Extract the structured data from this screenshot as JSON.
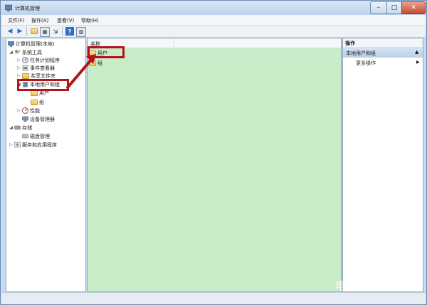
{
  "window": {
    "title": "计算机管理"
  },
  "menubar": {
    "items": [
      "文件(F)",
      "操作(A)",
      "查看(V)",
      "帮助(H)"
    ]
  },
  "tree": {
    "root": "计算机管理(本地)",
    "system_tools": "系统工具",
    "task_scheduler": "任务计划程序",
    "event_viewer": "事件查看器",
    "shared_folders": "共享文件夹",
    "local_users_groups": "本地用户和组",
    "users": "用户",
    "groups": "组",
    "performance": "性能",
    "device_manager": "设备管理器",
    "storage": "存储",
    "disk_management": "磁盘管理",
    "services_apps": "服务和应用程序"
  },
  "list": {
    "column_name": "名称",
    "rows": [
      "用户",
      "组"
    ]
  },
  "actions": {
    "header": "操作",
    "section": "本地用户和组",
    "more": "更多操作"
  },
  "watermark": "电脑百事网",
  "colors": {
    "highlight_red": "#b5121b",
    "list_bg": "#c8ecc8"
  }
}
